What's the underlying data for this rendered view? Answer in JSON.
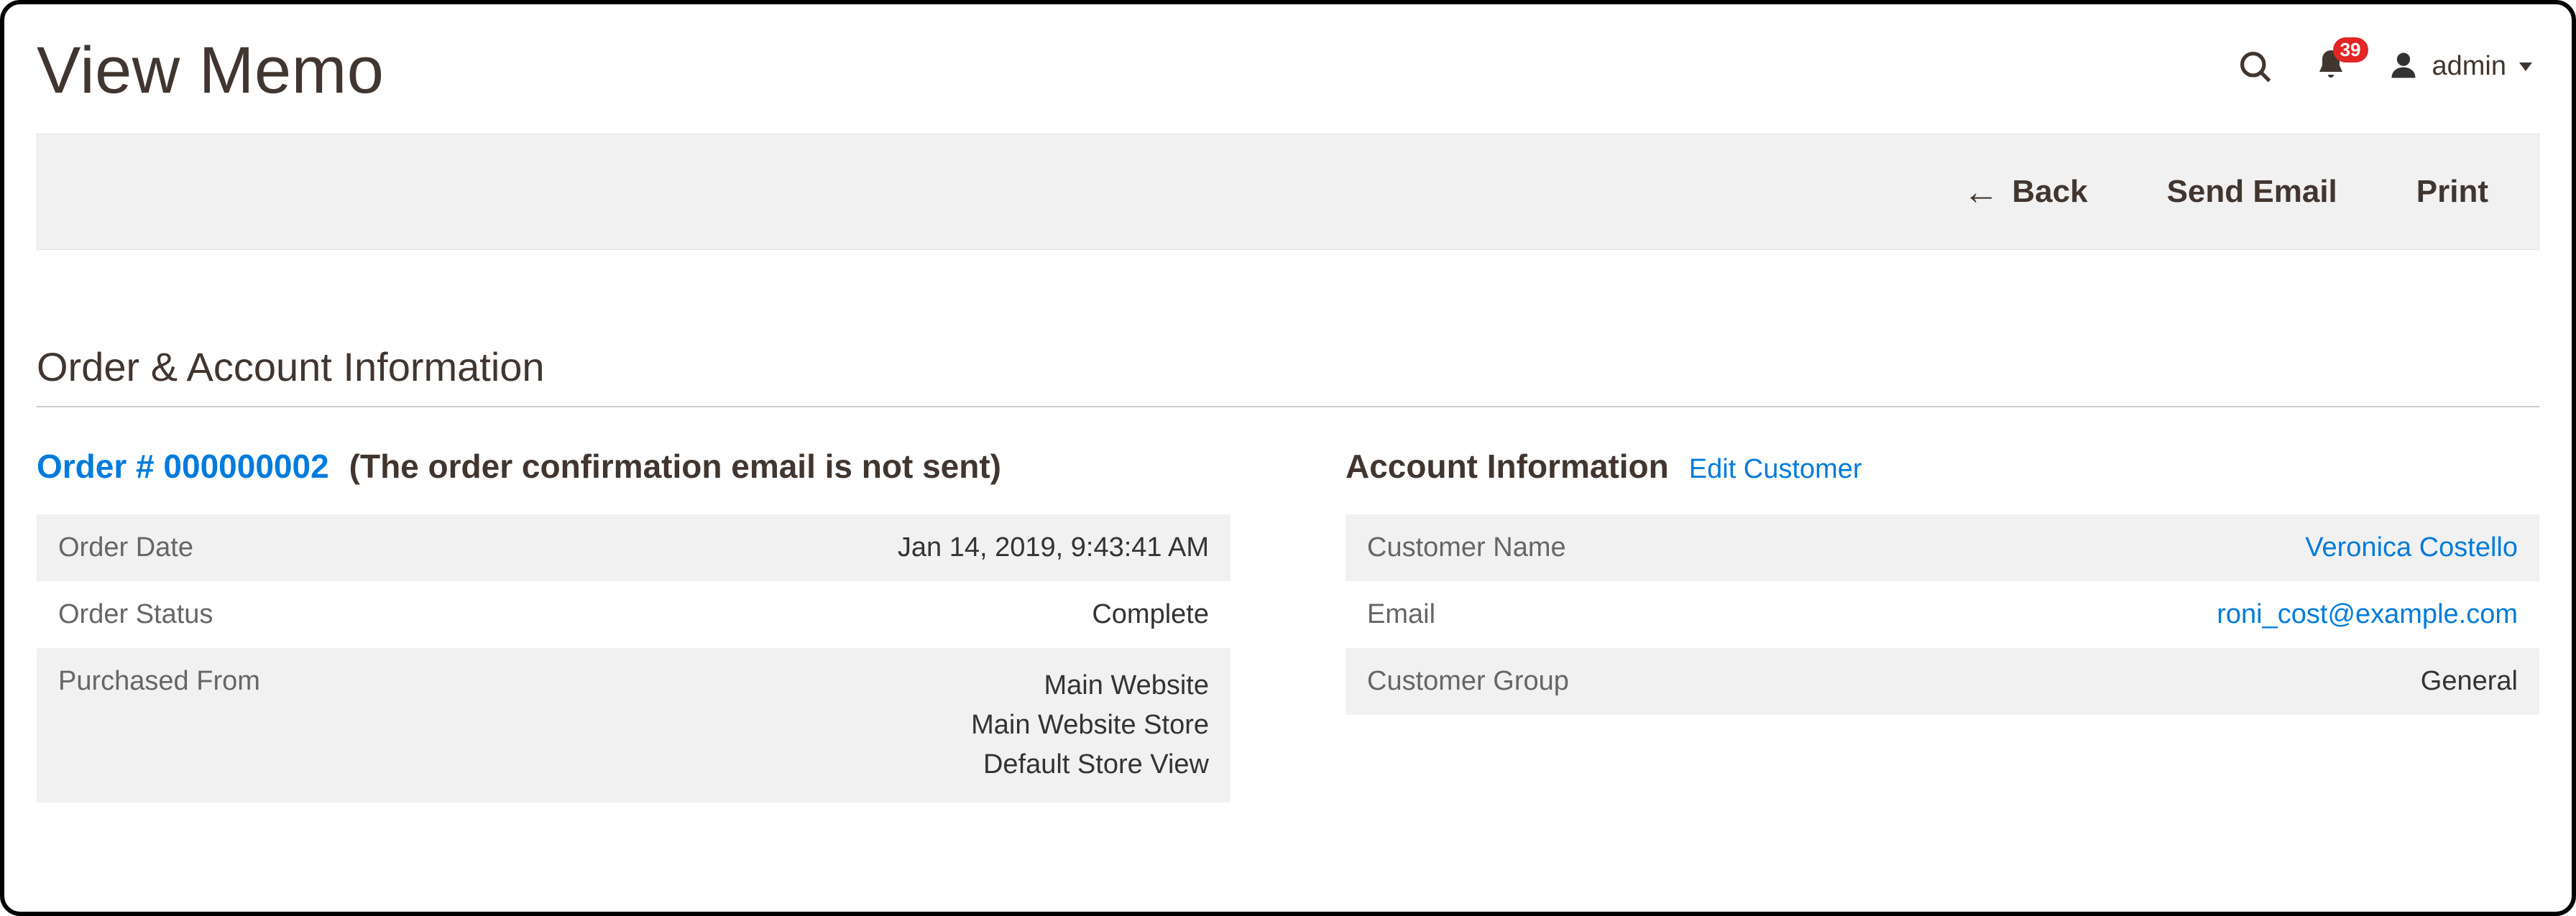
{
  "header": {
    "title": "View Memo",
    "notification_count": "39",
    "user_name": "admin"
  },
  "actions": {
    "back": "Back",
    "send_email": "Send Email",
    "print": "Print"
  },
  "section_title": "Order & Account Information",
  "order_panel": {
    "order_link": "Order # 000000002",
    "order_note": "(The order confirmation email is not sent)",
    "rows": {
      "order_date_label": "Order Date",
      "order_date_value": "Jan 14, 2019, 9:43:41 AM",
      "order_status_label": "Order Status",
      "order_status_value": "Complete",
      "purchased_from_label": "Purchased From",
      "purchased_from_value_1": "Main Website",
      "purchased_from_value_2": "Main Website Store",
      "purchased_from_value_3": "Default Store View"
    }
  },
  "account_panel": {
    "heading": "Account Information",
    "edit_link": "Edit Customer",
    "rows": {
      "customer_name_label": "Customer Name",
      "customer_name_value": "Veronica Costello",
      "email_label": "Email",
      "email_value": "roni_cost@example.com",
      "customer_group_label": "Customer Group",
      "customer_group_value": "General"
    }
  }
}
